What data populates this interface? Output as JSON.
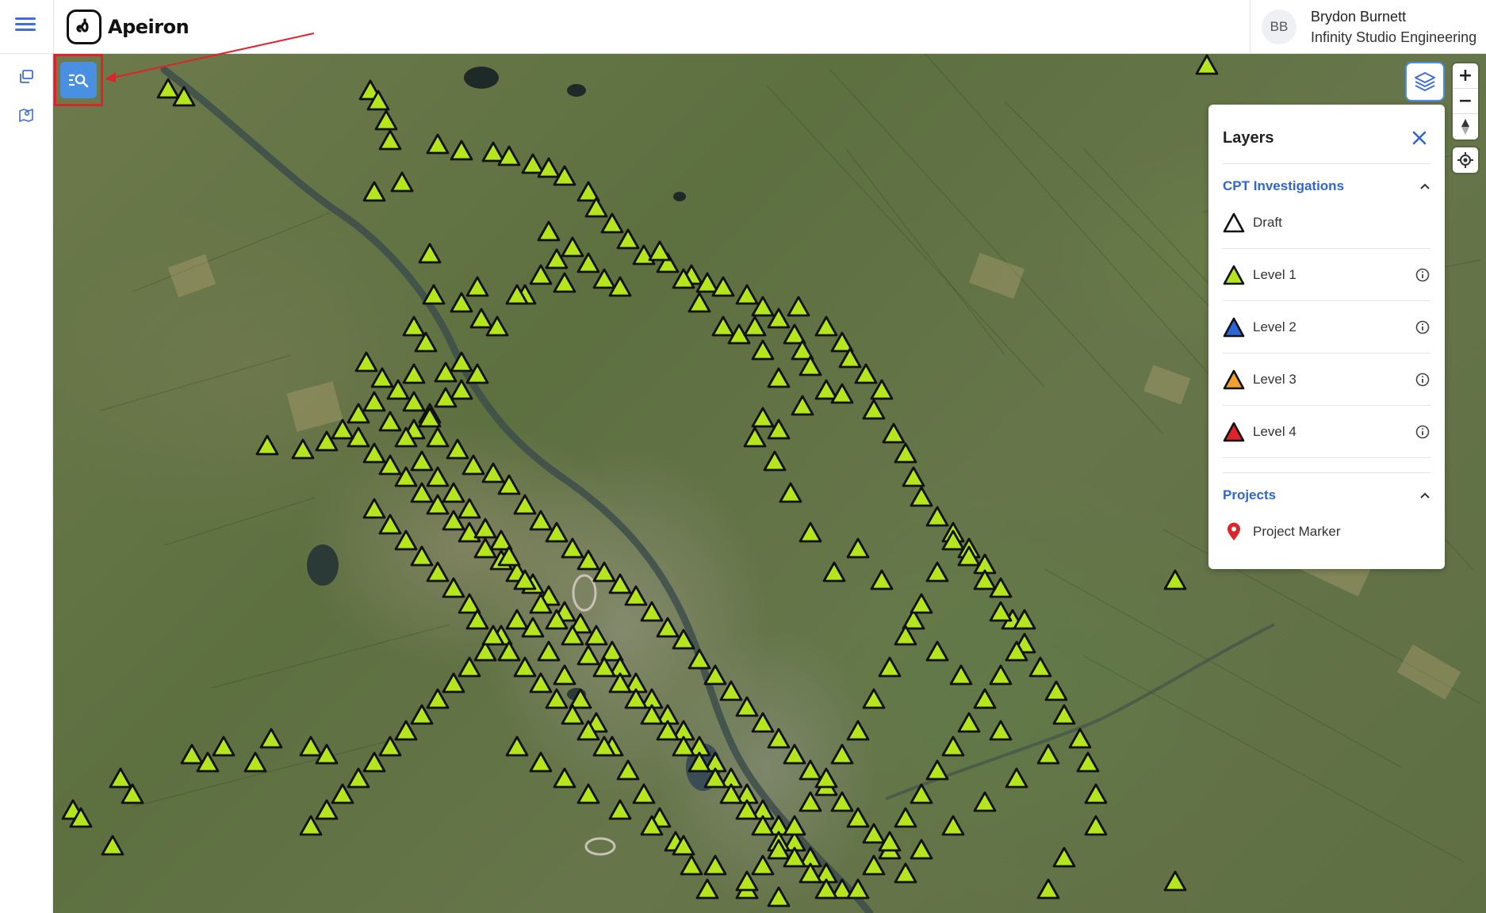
{
  "app": {
    "brand": "Apeiron",
    "menu_icon": "hamburger-menu-icon"
  },
  "user": {
    "initials": "BB",
    "name": "Brydon Burnett",
    "organization": "Infinity Studio Engineering"
  },
  "sidebar": {
    "items": [
      {
        "icon": "projects-stack-icon"
      },
      {
        "icon": "map-pin-icon"
      }
    ]
  },
  "map_controls": {
    "search_filter_icon": "search-filter-icon",
    "layers_icon": "layers-icon",
    "zoom_in": "+",
    "zoom_out": "−",
    "compass_icon": "compass-icon",
    "locate_icon": "locate-icon"
  },
  "layers_panel": {
    "title": "Layers",
    "sections": [
      {
        "title": "CPT Investigations",
        "expanded": true,
        "items": [
          {
            "label": "Draft",
            "color": "#ffffff",
            "info": false
          },
          {
            "label": "Level 1",
            "color": "#b5e61d",
            "info": true
          },
          {
            "label": "Level 2",
            "color": "#2b66d9",
            "info": true
          },
          {
            "label": "Level 3",
            "color": "#f0a030",
            "info": true
          },
          {
            "label": "Level 4",
            "color": "#e0222b",
            "info": true
          }
        ]
      },
      {
        "title": "Projects",
        "expanded": true,
        "items": [
          {
            "label": "Project Marker",
            "color": "#e0222b"
          }
        ]
      }
    ]
  },
  "colors": {
    "accent": "#4a90e2",
    "brand_blue": "#2f66d0",
    "marker_level1": "#b5e61d",
    "highlight": "#e0222b"
  }
}
